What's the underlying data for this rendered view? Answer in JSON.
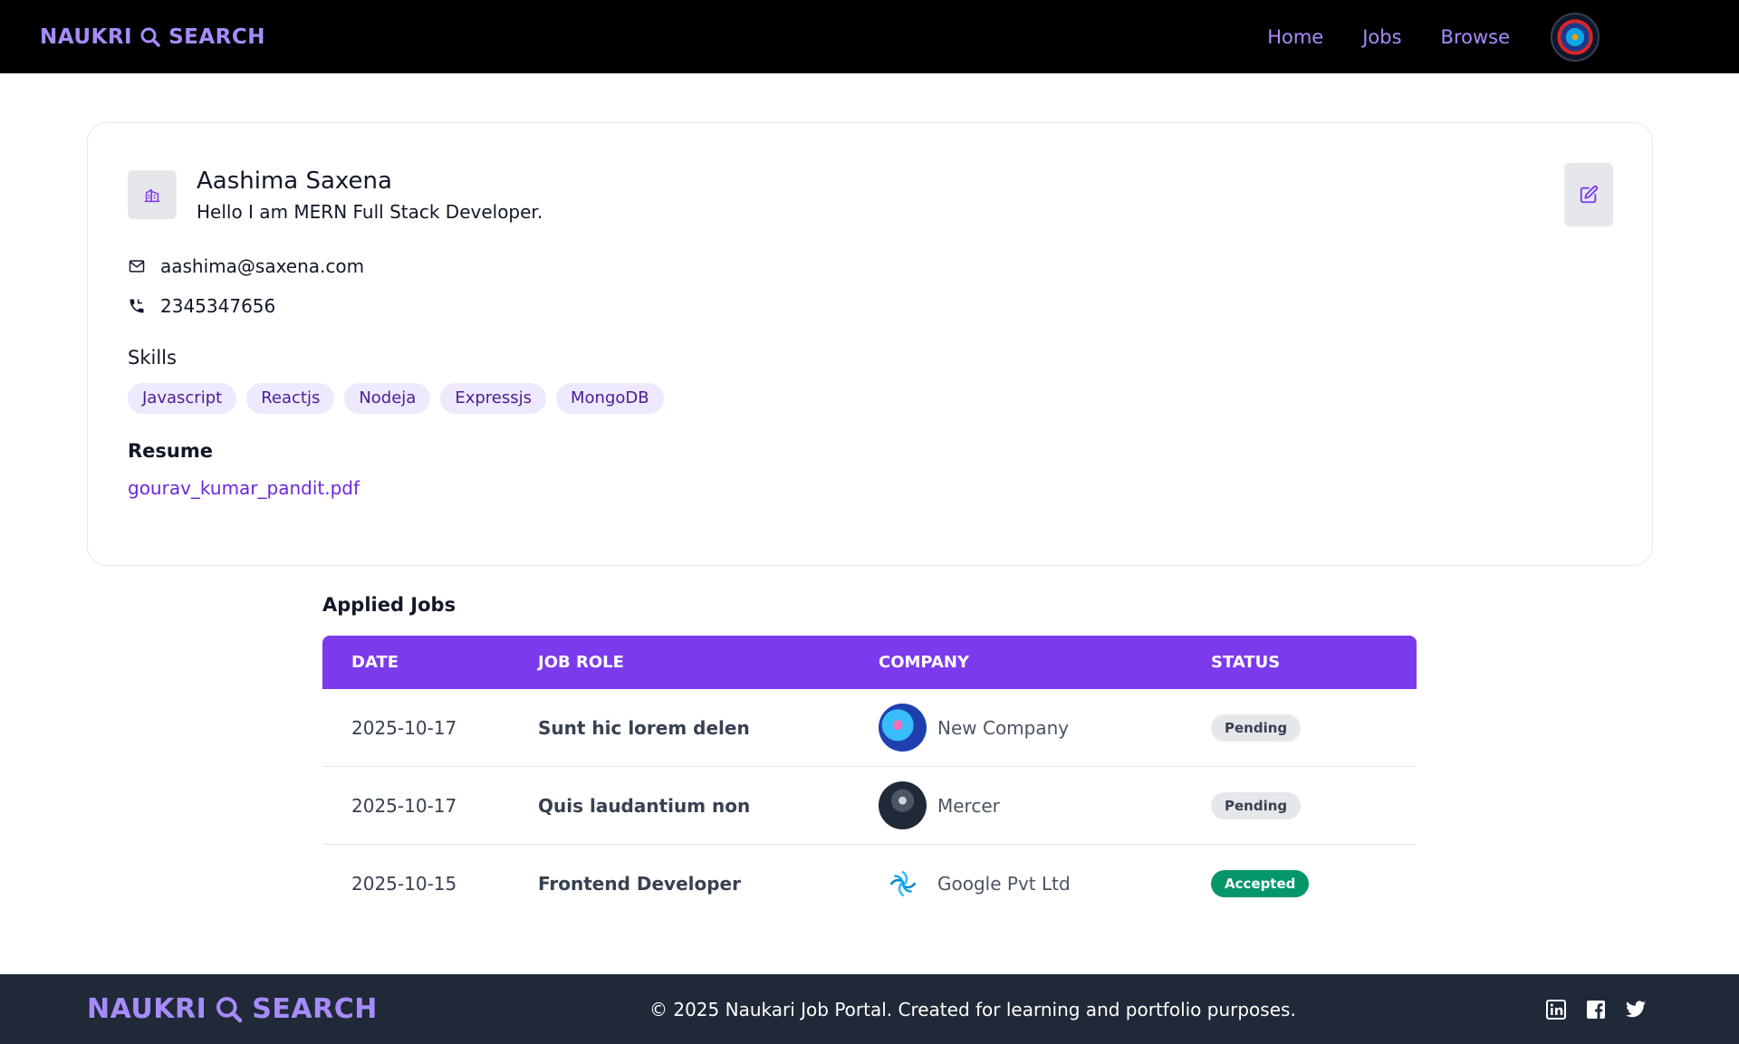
{
  "brand": {
    "left": "NAUKRI",
    "right": "SEARCH"
  },
  "nav": {
    "links": [
      {
        "label": "Home"
      },
      {
        "label": "Jobs"
      },
      {
        "label": "Browse"
      }
    ]
  },
  "profile": {
    "name": "Aashima Saxena",
    "bio": "Hello I am MERN Full Stack Developer.",
    "email": "aashima@saxena.com",
    "phone": "2345347656",
    "skills_title": "Skills",
    "skills": [
      "Javascript",
      "Reactjs",
      "Nodeja",
      "Expressjs",
      "MongoDB"
    ],
    "resume_title": "Resume",
    "resume_file": "gourav_kumar_pandit.pdf"
  },
  "applied": {
    "title": "Applied Jobs",
    "headers": {
      "date": "DATE",
      "role": "JOB ROLE",
      "company": "COMPANY",
      "status": "STATUS"
    },
    "rows": [
      {
        "date": "2025-10-17",
        "role": "Sunt hic lorem delen",
        "company": "New Company",
        "status": "Pending"
      },
      {
        "date": "2025-10-17",
        "role": "Quis laudantium non",
        "company": "Mercer",
        "status": "Pending"
      },
      {
        "date": "2025-10-15",
        "role": "Frontend Developer",
        "company": "Google Pvt Ltd",
        "status": "Accepted"
      }
    ]
  },
  "footer": {
    "copyright": "© 2025 Naukari Job Portal. Created for learning and portfolio purposes."
  },
  "colors": {
    "brand": "#a78bfa",
    "table_header": "#7c3aed",
    "accepted": "#059669",
    "pending": "#e5e7eb"
  }
}
